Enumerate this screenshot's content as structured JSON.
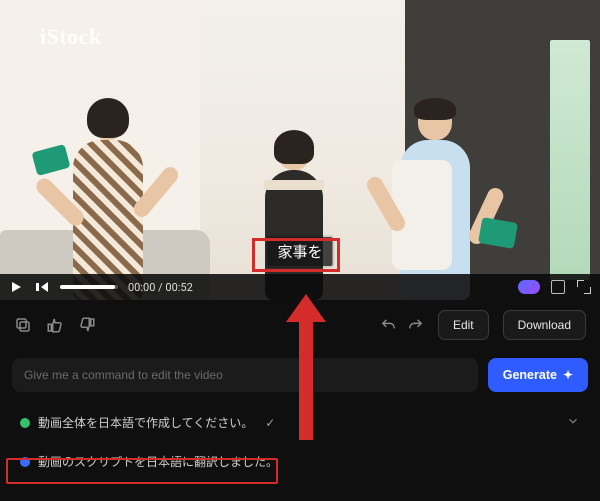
{
  "watermark": "iStock",
  "caption": "家事を",
  "player": {
    "current_time": "00:00",
    "duration": "00:52",
    "time_sep": " / "
  },
  "actions": {
    "edit": "Edit",
    "download": "Download"
  },
  "command": {
    "placeholder": "Give me a command to edit the video",
    "generate": "Generate"
  },
  "history": [
    {
      "dot": "green",
      "text": "動画全体を日本語で作成してください。",
      "checked": true
    },
    {
      "dot": "blue",
      "text": "動画のスクリプトを日本語に翻訳しました。",
      "checked": false
    }
  ]
}
